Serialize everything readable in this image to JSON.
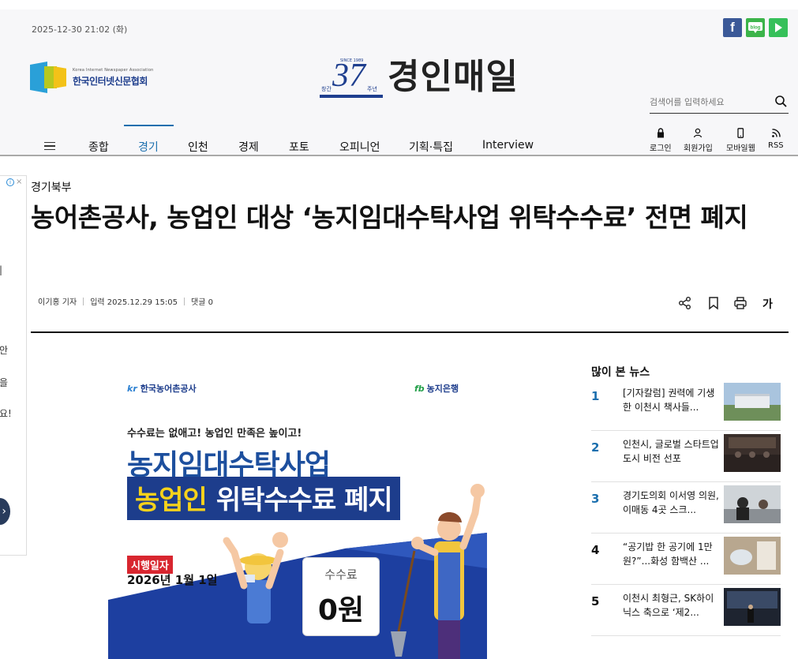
{
  "header": {
    "date": "2025-12-30 21:02 (화)",
    "association_en": "Korea Internet Newspaper Association",
    "association_ko": "한국인터넷신문협회",
    "anniversary_num": "37",
    "anniversary_left": "창간",
    "anniversary_right": "주년",
    "anniversary_top": "SINCE 1989",
    "logo_name": "경인매일",
    "search_placeholder": "검색어를 입력하세요",
    "social": {
      "facebook": "f",
      "blog": "blog"
    }
  },
  "nav": {
    "items": [
      "종합",
      "경기",
      "인천",
      "경제",
      "포토",
      "오피니언",
      "기획·특집",
      "Interview"
    ],
    "active": "경기"
  },
  "utils": [
    "로그인",
    "회원가입",
    "모바일웹",
    "RSS"
  ],
  "left_ad": {
    "fragments": [
      "|",
      "안",
      "을",
      "요!"
    ],
    "arrow": "›"
  },
  "article": {
    "category": "경기북부",
    "headline": "농어촌공사, 농업인 대상 ‘농지임대수탁사업 위탁수수료’ 전면 폐지",
    "reporter": "이기홍 기자",
    "published": "입력 2025.12.29 15:05",
    "comments": "댓글 0",
    "font_tool": "가"
  },
  "hero": {
    "org_left": "한국농어촌공사",
    "org_left_mark": "kr",
    "org_right": "농지은행",
    "org_right_mark": "fb",
    "subtitle": "수수료는 없애고! 농업인 만족은 높이고!",
    "title_line1": "농지임대수탁사업",
    "title_line2_highlight": "농업인",
    "title_line2_rest": "위탁수수료 폐지",
    "date_label": "시행일자",
    "date_value": "2026년 1월 1일",
    "fee_label": "수수료",
    "fee_value": "0원",
    "colors": {
      "navy": "#1d3d8c",
      "yellow": "#f6d21b",
      "red": "#d8262f"
    }
  },
  "popular": {
    "title": "많이 본 뉴스",
    "items": [
      {
        "num": "1",
        "text": "[기자칼럼] 권력에 기생한 이천시 책사들..."
      },
      {
        "num": "2",
        "text": "인천시, 글로벌 스타트업 도시 비전 선포"
      },
      {
        "num": "3",
        "text": "경기도의회 이서영 의원, 이매동 4곳 스크..."
      },
      {
        "num": "4",
        "text": "“공기밥 한 공기에 1만원?”...화성 함백산 ..."
      },
      {
        "num": "5",
        "text": "이천시 최형근, SK하이닉스 축으로 ‘제2..."
      }
    ]
  },
  "colors": {
    "accent": "#1b6fae",
    "facebook": "#3b5998",
    "blog": "#3cb44a"
  }
}
